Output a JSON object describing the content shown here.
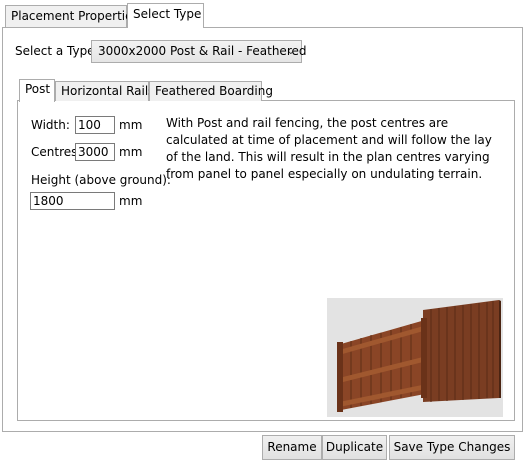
{
  "tabs": {
    "placement_properties": "Placement Properties",
    "select_type": "Select Type"
  },
  "type_selector": {
    "label": "Select a Type:",
    "selected": "3000x2000 Post & Rail - Feathered"
  },
  "inner_tabs": {
    "post": "Post",
    "horizontal_rails": "Horizontal Rails",
    "feathered_boarding": "Feathered Boarding"
  },
  "post": {
    "width_label": "Width:",
    "width_value": "100",
    "width_unit": "mm",
    "centres_label": "Centres:",
    "centres_value": "3000",
    "centres_unit": "mm",
    "height_label": "Height (above ground):",
    "height_value": "1800",
    "height_unit": "mm",
    "description": "With Post and rail fencing, the post centres are calculated at time of placement and will follow the lay of the land. This will result in the plan centres varying from panel to panel especially on undulating terrain."
  },
  "buttons": {
    "rename": "Rename",
    "duplicate": "Duplicate",
    "save": "Save Type Changes"
  },
  "icons": {
    "dropdown": "chevron-down-icon",
    "preview": "fence-preview-image"
  },
  "colors": {
    "border": "#acacac",
    "preview_bg": "#e3e3e3",
    "wood": "#7a3d22"
  }
}
